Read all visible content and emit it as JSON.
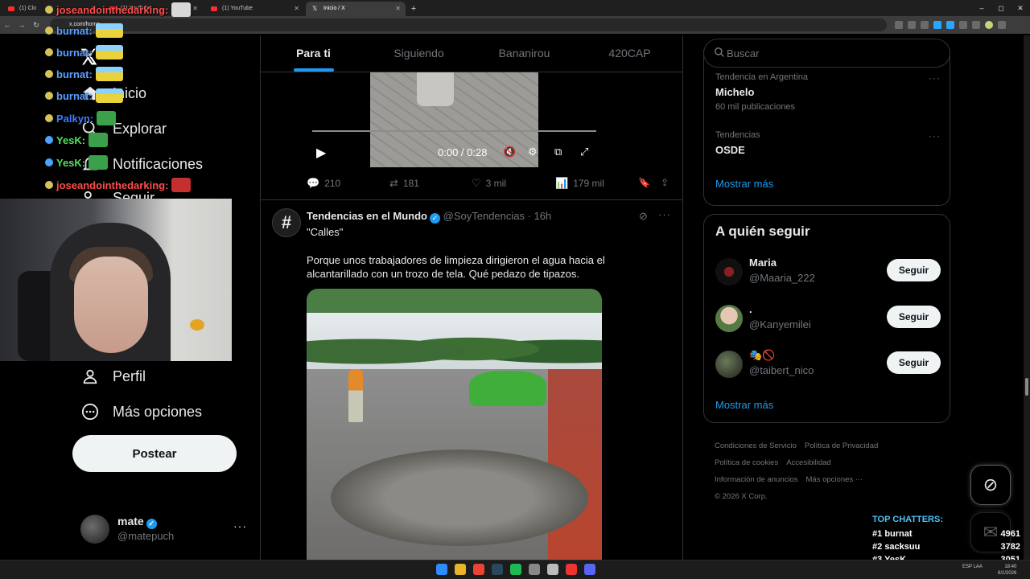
{
  "browser": {
    "tabs": [
      {
        "title": "(1) Clo",
        "favicon": "youtube-icon",
        "active": false
      },
      {
        "title": "(1) YouTube",
        "favicon": "youtube-icon",
        "active": false
      },
      {
        "title": "(1) YouTube",
        "favicon": "youtube-icon",
        "active": false
      },
      {
        "title": "Inicio / X",
        "favicon": "x-icon",
        "active": true
      }
    ],
    "new_tab": "+",
    "url": "x.com/home",
    "window_controls": {
      "minimize": "–",
      "maximize": "◻",
      "close": "✕"
    }
  },
  "chat_overlay": [
    {
      "nick": "joseandointhedarking:",
      "color": "#ff4d4d",
      "emote": "gray"
    },
    {
      "nick": "burnat:",
      "color": "#5aa0ff",
      "emote": "car"
    },
    {
      "nick": "burnat:",
      "color": "#5aa0ff",
      "emote": "car"
    },
    {
      "nick": "burnat:",
      "color": "#5aa0ff",
      "emote": "car"
    },
    {
      "nick": "burnat:",
      "color": "#5aa0ff",
      "emote": "car"
    },
    {
      "nick": "Palkyn:",
      "color": "#3f7bff",
      "emote": "green"
    },
    {
      "nick": "YesK:",
      "color": "#55e05a",
      "emote": "green"
    },
    {
      "nick": "YesK:",
      "color": "#55e05a",
      "emote": "green"
    },
    {
      "nick": "joseandointhedarking:",
      "color": "#ff4d4d",
      "emote": "santa"
    }
  ],
  "sidebar": {
    "logo": "𝕏",
    "items": [
      {
        "label": "Inicio",
        "icon": "home-icon"
      },
      {
        "label": "Explorar",
        "icon": "search-icon"
      },
      {
        "label": "Notificaciones",
        "icon": "bell-icon"
      },
      {
        "label": "Seguir",
        "icon": "add-user-icon"
      },
      {
        "label": "Perfil",
        "icon": "user-icon"
      },
      {
        "label": "Más opciones",
        "icon": "more-circle-icon"
      }
    ],
    "post_button": "Postear",
    "account": {
      "name": "mate",
      "handle": "@matepuch",
      "more": "···"
    }
  },
  "feed": {
    "tabs": [
      {
        "label": "Para ti",
        "active": true
      },
      {
        "label": "Siguiendo",
        "active": false
      },
      {
        "label": "Bananirou",
        "active": false
      },
      {
        "label": "420CAP",
        "active": false
      }
    ],
    "video1": {
      "time": "0:00 / 0:28"
    },
    "actions": {
      "replies": "210",
      "reposts": "181",
      "likes": "3 mil",
      "views": "179 mil"
    },
    "tweet": {
      "name": "Tendencias en el Mundo",
      "handle": "@SoyTendencias",
      "time": "· 16h",
      "quote": "\"Calles\"",
      "body": "Porque unos trabajadores de limpieza dirigieron el agua hacia el alcantarillado con un trozo de tela. Qué pedazo de tipazos.",
      "avatar_glyph": "#",
      "more": "···"
    }
  },
  "right": {
    "search": {
      "placeholder": "Buscar"
    },
    "trends": [
      {
        "category": "Tendencia en Argentina",
        "name": "Michelo",
        "count": "60 mil publicaciones"
      },
      {
        "category": "Tendencias",
        "name": "OSDE",
        "count": ""
      }
    ],
    "trends_more": "Mostrar más",
    "follow": {
      "title": "A quién seguir",
      "items": [
        {
          "name": "Maria",
          "handle": "@Maaria_222",
          "button": "Seguir"
        },
        {
          "name": ".",
          "handle": "@Kanyemilei",
          "button": "Seguir"
        },
        {
          "name": "🎭🚫",
          "handle": "@taibert_nico",
          "button": "Seguir"
        }
      ],
      "more": "Mostrar más"
    },
    "footer": {
      "links": [
        "Condiciones de Servicio",
        "Política de Privacidad",
        "Política de cookies",
        "Accesibilidad",
        "Información de anuncios",
        "Más opciones ···"
      ],
      "copyright": "© 2026 X Corp."
    }
  },
  "top_chatters": {
    "title": "TOP CHATTERS:",
    "rows": [
      {
        "rank": "#1",
        "name": "burnat",
        "count": "4961"
      },
      {
        "rank": "#2",
        "name": "sacksuu",
        "count": "3782"
      },
      {
        "rank": "#3",
        "name": "YesK",
        "count": "3051"
      }
    ]
  },
  "taskbar": {
    "lang": "ESP LAA",
    "time": "18:40",
    "date": "6/1/2026"
  },
  "colors": {
    "accent": "#1d9bf0",
    "background": "#000000",
    "border": "#2f3336",
    "secondary_text": "#71767b"
  }
}
